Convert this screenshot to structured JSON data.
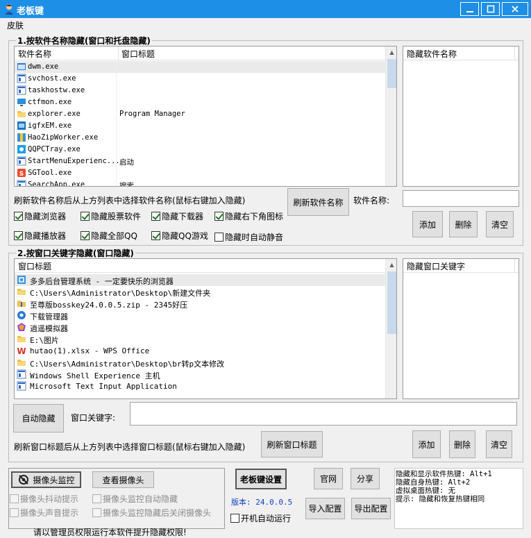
{
  "window": {
    "title": "老板键"
  },
  "menu": {
    "skin": "皮肤"
  },
  "section1": {
    "legend": "1.按软件名称隐藏(窗口和托盘隐藏)",
    "col_name": "软件名称",
    "col_title": "窗口标题",
    "rows": [
      {
        "name": "dwm.exe",
        "title": "",
        "icon": "window-icon"
      },
      {
        "name": "svchost.exe",
        "title": "",
        "icon": "app-icon"
      },
      {
        "name": "taskhostw.exe",
        "title": "",
        "icon": "app-icon"
      },
      {
        "name": "ctfmon.exe",
        "title": "",
        "icon": "monitor-icon"
      },
      {
        "name": "explorer.exe",
        "title": "Program Manager",
        "icon": "folder-icon"
      },
      {
        "name": "igfxEM.exe",
        "title": "",
        "icon": "intel-icon"
      },
      {
        "name": "HaoZipWorker.exe",
        "title": "",
        "icon": "haozip-icon"
      },
      {
        "name": "QQPCTray.exe",
        "title": "",
        "icon": "qqpc-icon"
      },
      {
        "name": "StartMenuExperienc...",
        "title": "启动",
        "icon": "app-icon"
      },
      {
        "name": "SGTool.exe",
        "title": "",
        "icon": "sogou-icon"
      },
      {
        "name": "SearchApp.exe",
        "title": "搜索",
        "icon": "app-icon"
      }
    ],
    "hidden_header": "隐藏软件名称",
    "hint": "刷新软件名称后从上方列表中选择软件名称(鼠标右键加入隐藏)",
    "refresh_button": "刷新软件名称",
    "name_label": "软件名称:",
    "name_value": "",
    "add_button": "添加",
    "delete_button": "删除",
    "clear_button": "清空",
    "checkboxes": [
      {
        "label": "隐藏浏览器",
        "checked": true
      },
      {
        "label": "隐藏股票软件",
        "checked": true
      },
      {
        "label": "隐藏下载器",
        "checked": true
      },
      {
        "label": "隐藏右下角图标",
        "checked": true
      },
      {
        "label": "隐藏播放器",
        "checked": true
      },
      {
        "label": "隐藏全部QQ",
        "checked": true
      },
      {
        "label": "隐藏QQ游戏",
        "checked": true
      },
      {
        "label": "隐藏时自动静音",
        "checked": false
      }
    ]
  },
  "section2": {
    "legend": "2.按窗口关键字隐藏(窗口隐藏)",
    "col_title": "窗口标题",
    "rows": [
      {
        "title": "多多后台管理系统 - 一定要快乐的浏览器",
        "icon": "browser-icon"
      },
      {
        "title": "C:\\Users\\Administrator\\Desktop\\新建文件夹",
        "icon": "folder-icon"
      },
      {
        "title": "至尊版bosskey24.0.0.5.zip - 2345好压",
        "icon": "zip-folder-icon"
      },
      {
        "title": "下载管理器",
        "icon": "download-icon"
      },
      {
        "title": "逍遥模拟器",
        "icon": "emulator-icon"
      },
      {
        "title": "E:\\图片",
        "icon": "folder-icon"
      },
      {
        "title": "hutao(1).xlsx - WPS Office",
        "icon": "wps-icon"
      },
      {
        "title": "C:\\Users\\Administrator\\Desktop\\br转p文本修改",
        "icon": "folder-icon"
      },
      {
        "title": "Windows Shell Experience 主机",
        "icon": "app-icon"
      },
      {
        "title": "Microsoft Text Input Application",
        "icon": "app-icon"
      }
    ],
    "hidden_header": "隐藏窗口关键字",
    "auto_hide_button": "自动隐藏",
    "keyword_label": "窗口关键字:",
    "keyword_value": "",
    "hint": "刷新窗口标题后从上方列表中选择窗口标题(鼠标右键加入隐藏)",
    "refresh_button": "刷新窗口标题",
    "add_button": "添加",
    "delete_button": "删除",
    "clear_button": "清空"
  },
  "bottom": {
    "camera_monitor_button": "摄像头监控",
    "view_camera_button": "查看摄像头",
    "camera_checks": [
      {
        "label": "摄像头抖动提示",
        "checked": false
      },
      {
        "label": "摄像头监控自动隐藏",
        "checked": false
      },
      {
        "label": "摄像头声音提示",
        "checked": false
      },
      {
        "label": "摄像头监控隐藏后关闭摄像头",
        "checked": false
      }
    ],
    "settings_button": "老板键设置",
    "version": "版本: 24.0.0.5",
    "autorun_label": "开机自动运行",
    "autorun_checked": false,
    "official_button": "官网",
    "share_button": "分享",
    "import_button": "导入配置",
    "export_button": "导出配置",
    "hotkeys": [
      "隐藏和显示软件热键: Alt+1",
      "隐藏自身热键: Alt+2",
      "虚拟桌面热键: 无",
      "提示: 隐藏和恢复热键相同"
    ],
    "admin_notice": "请以管理员权限运行本软件提升隐藏权限!"
  },
  "colors": {
    "titlebar": "#1e8fe6",
    "checkmark": "#1a7a1a",
    "selection": "#eaeaea"
  }
}
